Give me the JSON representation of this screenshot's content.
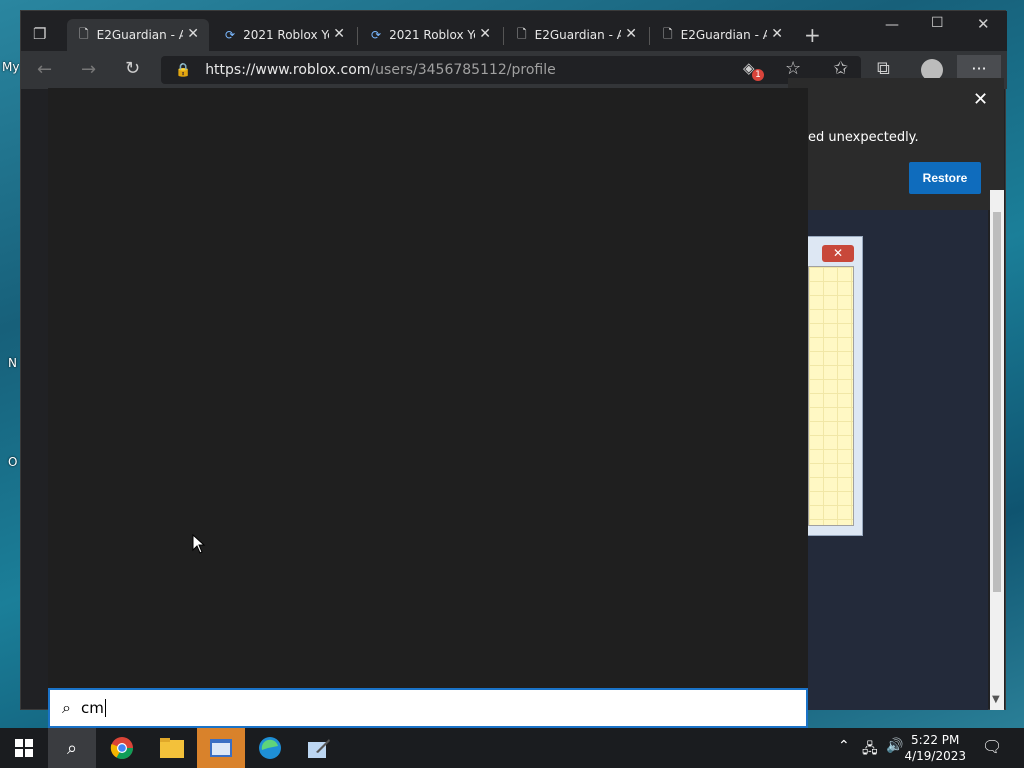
{
  "desktop": {
    "icon_labels": [
      "My",
      "N",
      "O"
    ]
  },
  "browser": {
    "tabs": [
      {
        "label": "E2Guardian - A",
        "icon": "page-icon",
        "active": true
      },
      {
        "label": "2021 Roblox Ye",
        "icon": "loading-icon",
        "active": false
      },
      {
        "label": "2021 Roblox Ye",
        "icon": "loading-icon",
        "active": false
      },
      {
        "label": "E2Guardian - A",
        "icon": "page-icon",
        "active": false
      },
      {
        "label": "E2Guardian - A",
        "icon": "page-icon",
        "active": false
      }
    ],
    "new_tab_symbol": "+",
    "url_host": "https://www.roblox.com",
    "url_path": "/users/3456785112/profile",
    "tracking_badge": "1",
    "restore_message": "ed unexpectedly.",
    "restore_label": "Restore"
  },
  "search": {
    "query": "cm"
  },
  "taskbar": {
    "time": "5:22 PM",
    "date": "4/19/2023"
  },
  "colors": {
    "accent": "#0f6cbd",
    "start_panel": "#1f1f1f",
    "taskbar": "#1a1c1f"
  }
}
